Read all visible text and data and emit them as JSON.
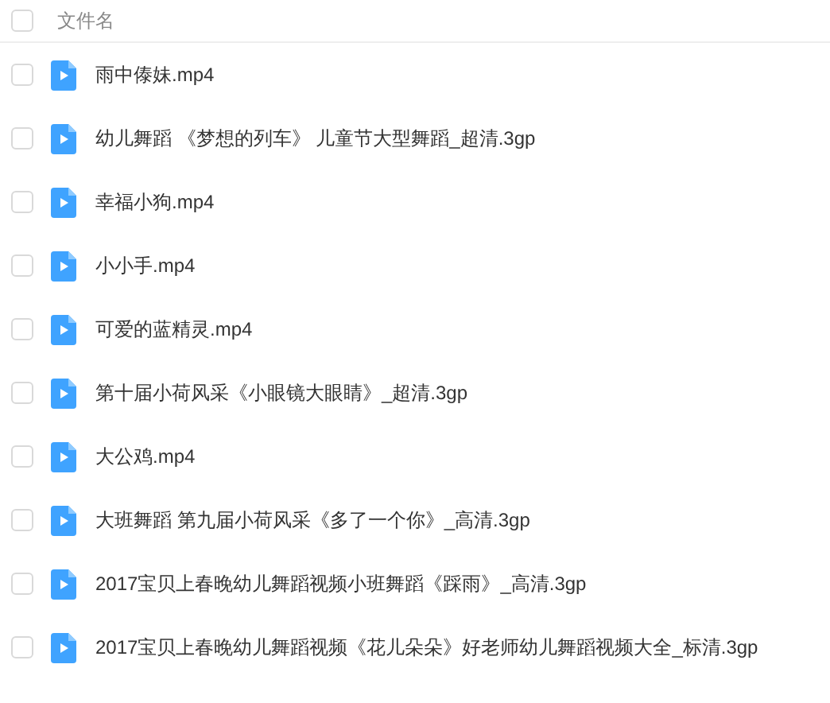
{
  "header": {
    "select_all_checked": false,
    "column_label": "文件名"
  },
  "files": [
    {
      "name": "雨中傣妹.mp4",
      "checked": false
    },
    {
      "name": "幼儿舞蹈 《梦想的列车》 儿童节大型舞蹈_超清.3gp",
      "checked": false
    },
    {
      "name": "幸福小狗.mp4",
      "checked": false
    },
    {
      "name": "小小手.mp4",
      "checked": false
    },
    {
      "name": "可爱的蓝精灵.mp4",
      "checked": false
    },
    {
      "name": "第十届小荷风采《小眼镜大眼睛》_超清.3gp",
      "checked": false
    },
    {
      "name": "大公鸡.mp4",
      "checked": false
    },
    {
      "name": "大班舞蹈 第九届小荷风采《多了一个你》_高清.3gp",
      "checked": false
    },
    {
      "name": "2017宝贝上春晚幼儿舞蹈视频小班舞蹈《踩雨》_高清.3gp",
      "checked": false
    },
    {
      "name": "2017宝贝上春晚幼儿舞蹈视频《花儿朵朵》好老师幼儿舞蹈视频大全_标清.3gp",
      "checked": false
    }
  ]
}
